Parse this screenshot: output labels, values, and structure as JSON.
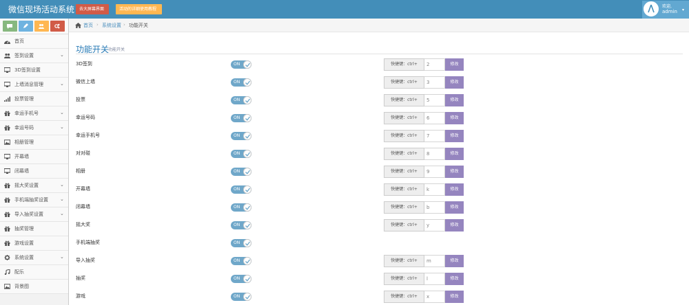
{
  "app": {
    "title": "微信现场活动系统",
    "buttons": {
      "big_screen": "去大屏幕界面",
      "guide": "活动的详细使用教程"
    }
  },
  "user": {
    "welcome": "欢迎,",
    "name": "admin"
  },
  "sidebar": {
    "items": [
      {
        "label": "首页",
        "icon": "dashboard-icon",
        "has_submenu": false
      },
      {
        "label": "签到设置",
        "icon": "users-icon",
        "has_submenu": true
      },
      {
        "label": "3D签到设置",
        "icon": "desktop-icon",
        "has_submenu": false
      },
      {
        "label": "上墙消息管理",
        "icon": "desktop-icon",
        "has_submenu": true
      },
      {
        "label": "投票管理",
        "icon": "signal-icon",
        "has_submenu": false
      },
      {
        "label": "幸运手机号",
        "icon": "gift-icon",
        "has_submenu": true
      },
      {
        "label": "幸运号码",
        "icon": "gift-icon",
        "has_submenu": true
      },
      {
        "label": "相册管理",
        "icon": "picture-icon",
        "has_submenu": false
      },
      {
        "label": "开幕墙",
        "icon": "desktop-icon",
        "has_submenu": false
      },
      {
        "label": "闭幕墙",
        "icon": "desktop-icon",
        "has_submenu": false
      },
      {
        "label": "摇大奖设置",
        "icon": "gift-icon",
        "has_submenu": true
      },
      {
        "label": "手机端抽奖设置",
        "icon": "gift-icon",
        "has_submenu": true
      },
      {
        "label": "导入抽奖设置",
        "icon": "gift-icon",
        "has_submenu": true
      },
      {
        "label": "抽奖管理",
        "icon": "gift-icon",
        "has_submenu": false
      },
      {
        "label": "游戏设置",
        "icon": "gift-icon",
        "has_submenu": false
      },
      {
        "label": "系统设置",
        "icon": "gear-icon",
        "has_submenu": true
      },
      {
        "label": "配乐",
        "icon": "music-icon",
        "has_submenu": false
      },
      {
        "label": "背景图",
        "icon": "picture-icon",
        "has_submenu": false
      }
    ]
  },
  "breadcrumb": [
    "首页",
    "系统设置",
    "功能开关"
  ],
  "page": {
    "title": "功能开关",
    "subtitle": "功能开关"
  },
  "settings": {
    "hotkey_prefix": "快捷键：ctrl+",
    "button_label": "修改",
    "toggle_label": "ON",
    "rows": [
      {
        "label": "3D签到",
        "key": "2",
        "has_hotkey": true
      },
      {
        "label": "微信上墙",
        "key": "3",
        "has_hotkey": true
      },
      {
        "label": "投票",
        "key": "5",
        "has_hotkey": true
      },
      {
        "label": "幸运号码",
        "key": "6",
        "has_hotkey": true
      },
      {
        "label": "幸运手机号",
        "key": "7",
        "has_hotkey": true
      },
      {
        "label": "对对碰",
        "key": "8",
        "has_hotkey": true
      },
      {
        "label": "相册",
        "key": "9",
        "has_hotkey": true
      },
      {
        "label": "开幕墙",
        "key": "k",
        "has_hotkey": true
      },
      {
        "label": "闭幕墙",
        "key": "b",
        "has_hotkey": true
      },
      {
        "label": "摇大奖",
        "key": "y",
        "has_hotkey": true
      },
      {
        "label": "手机端抽奖",
        "key": "",
        "has_hotkey": false
      },
      {
        "label": "导入抽奖",
        "key": "m",
        "has_hotkey": true
      },
      {
        "label": "抽奖",
        "key": "l",
        "has_hotkey": true
      },
      {
        "label": "游戏",
        "key": "x",
        "has_hotkey": true
      }
    ]
  },
  "colors": {
    "navbar": "#438eb9",
    "toggle_on": "#6fa7c9",
    "modify_button": "#9585bf",
    "title_blue": "#2679b5"
  }
}
